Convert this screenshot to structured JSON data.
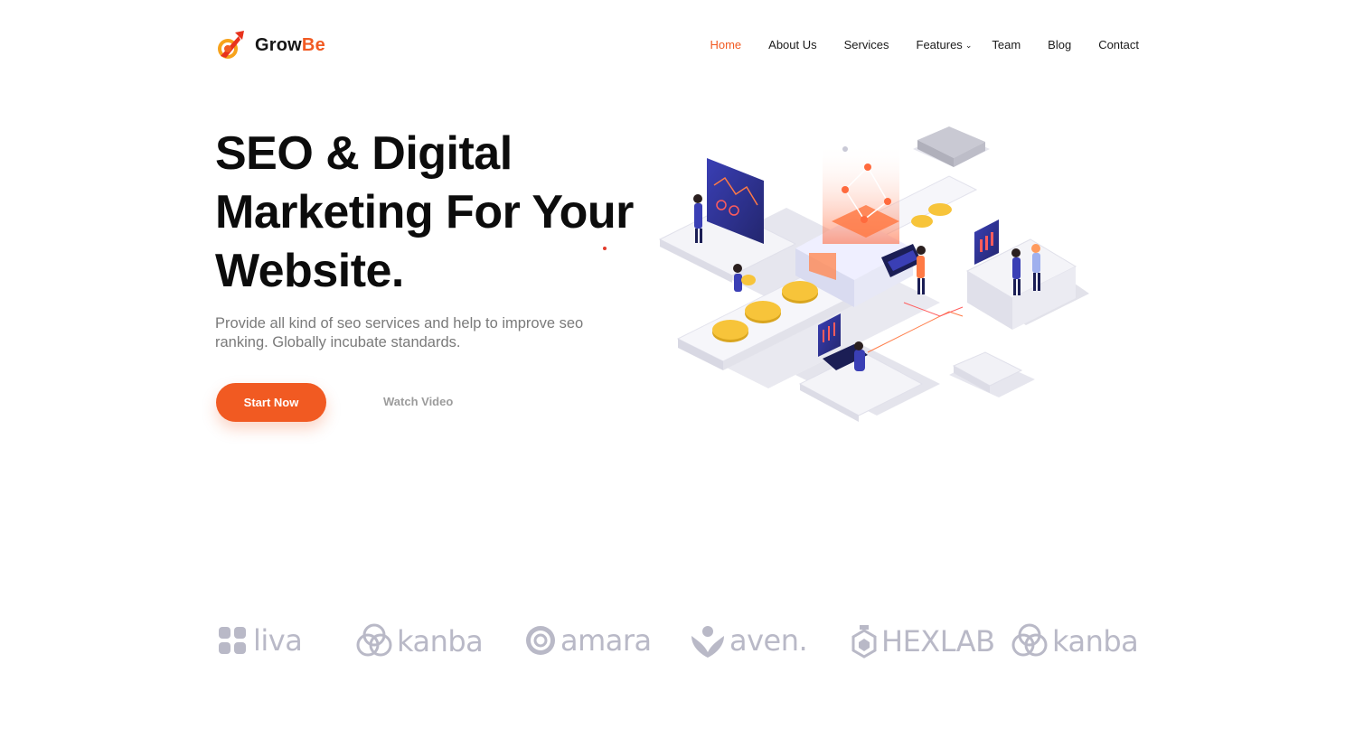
{
  "brand": {
    "name_part1": "Grow",
    "name_part2": "Be"
  },
  "nav": {
    "items": [
      "Home",
      "About Us",
      "Services",
      "Features",
      "Team",
      "Blog",
      "Contact"
    ],
    "active": "Home",
    "features_caret": "⌄"
  },
  "hero": {
    "title": "SEO & Digital Marketing For Your Website.",
    "subtitle": "Provide all kind of seo services and help to improve seo ranking. Globally incubate standards.",
    "primary_button": "Start Now",
    "secondary_button": "Watch Video"
  },
  "clients": [
    "liva",
    "kanba",
    "amara",
    "aven.",
    "HEXLAB",
    "kanba"
  ],
  "colors": {
    "accent": "#f15a22",
    "text": "#0c0c0c",
    "muted": "#7a7a7a",
    "logo_gray": "#b9b9c7",
    "illus_blue": "#3a3fb5"
  }
}
